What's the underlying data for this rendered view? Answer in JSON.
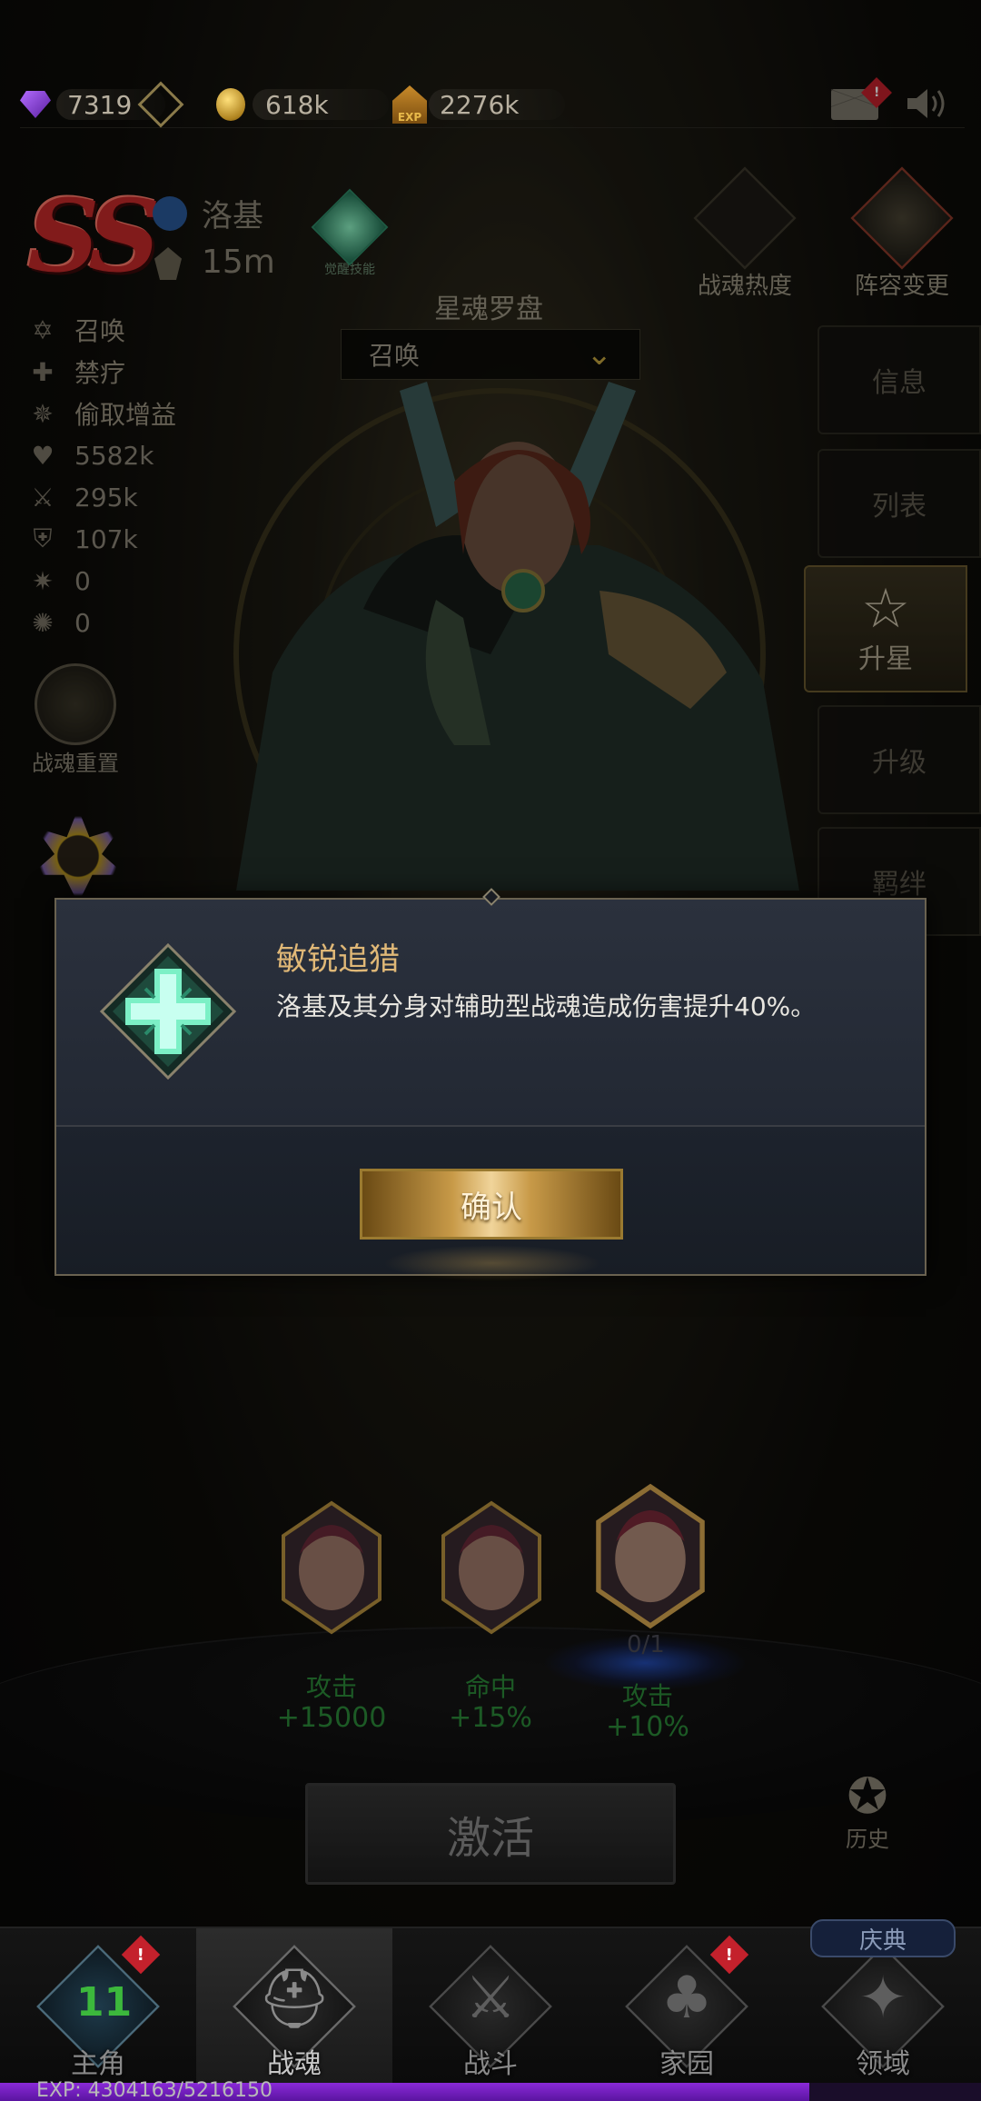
{
  "currency": {
    "gems": "7319",
    "gold": "618k",
    "exp": "2276k",
    "exp_icon_label": "EXP",
    "mail_badge": "!"
  },
  "hero": {
    "rank": "SS",
    "name": "洛基",
    "distance": "15m",
    "awaken_label": "觉醒技能",
    "skills": [
      "召唤",
      "禁疗",
      "偷取增益"
    ],
    "stats": [
      "5582k",
      "295k",
      "107k",
      "0",
      "0"
    ]
  },
  "left_buttons": {
    "reset": "战魂重置"
  },
  "right_menu": {
    "heat": "战魂热度",
    "lineup": "阵容变更",
    "tabs": [
      "信息",
      "列表",
      "升星",
      "升级",
      "羁绊"
    ]
  },
  "compass": {
    "title": "星魂罗盘",
    "selected": "召唤"
  },
  "dialog": {
    "title": "敏锐追猎",
    "description": "洛基及其分身对辅助型战魂造成伤害提升40%。",
    "confirm": "确认"
  },
  "bonuses": [
    {
      "stat": "攻击",
      "value": "+15000"
    },
    {
      "stat": "命中",
      "value": "+15%"
    },
    {
      "stat": "攻击",
      "value": "+10%",
      "progress": "0/1"
    }
  ],
  "activate": "激活",
  "history": "历史",
  "nav": {
    "items": [
      {
        "label": "主角",
        "level": "11",
        "badge": "!"
      },
      {
        "label": "战魂"
      },
      {
        "label": "战斗"
      },
      {
        "label": "家园",
        "badge": "!"
      },
      {
        "label": "领域"
      }
    ],
    "festival": "庆典"
  },
  "exp_bar": {
    "text": "EXP: 4304163/5216150",
    "current": 4304163,
    "max": 5216150
  },
  "colors": {
    "dialog_title": "#e0b877",
    "bonus_green": "#2c8a3a",
    "badge_red": "#c4212c",
    "exp_purple": "#8a2ad8"
  }
}
